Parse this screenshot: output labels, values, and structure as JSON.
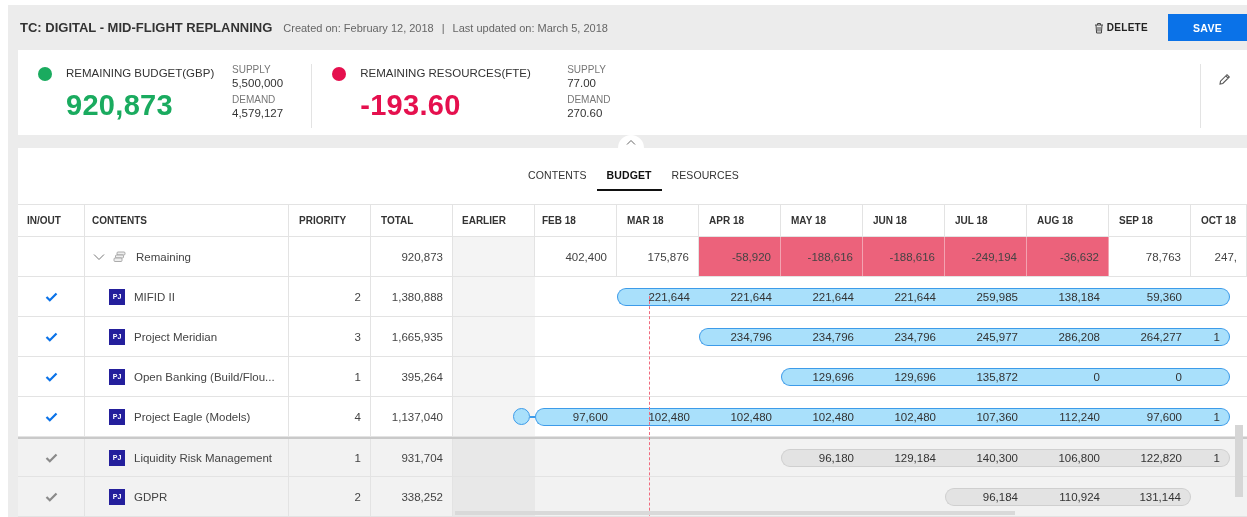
{
  "header": {
    "title": "TC: DIGITAL - MID-FLIGHT REPLANNING",
    "created": "Created on: February 12, 2018",
    "separator": "|",
    "updated": "Last updated on: March 5, 2018",
    "actions": [
      {
        "kind": "delete",
        "label": "DELETE"
      },
      {
        "kind": "save",
        "label": "SAVE"
      }
    ]
  },
  "summary": [
    {
      "label": "REMAINING BUDGET(GBP)",
      "color": "#1aab5f",
      "value": "920,873",
      "supply_label": "SUPPLY",
      "supply": "5,500,000",
      "demand_label": "DEMAND",
      "demand": "4,579,127"
    },
    {
      "label": "REMAINING RESOURCES(FTE)",
      "color": "#e5104e",
      "value": "-193.60",
      "supply_label": "SUPPLY",
      "supply": "77.00",
      "demand_label": "DEMAND",
      "demand": "270.60"
    }
  ],
  "tabs": [
    {
      "label": "CONTENTS",
      "selected": false
    },
    {
      "label": "BUDGET",
      "selected": true
    },
    {
      "label": "RESOURCES",
      "selected": false
    }
  ],
  "table": {
    "columns": [
      "IN/OUT",
      "CONTENTS",
      "PRIORITY",
      "TOTAL",
      "EARLIER",
      "FEB 18",
      "MAR 18",
      "APR 18",
      "MAY 18",
      "JUN 18",
      "JUL 18",
      "AUG 18",
      "SEP 18",
      "OCT 18"
    ],
    "rows": [
      {
        "kind": "summary",
        "name": "Remaining",
        "expanded": true,
        "total": "920,873",
        "cells": [
          {
            "value": "402,400",
            "negative": false
          },
          {
            "value": "175,876",
            "negative": false
          },
          {
            "value": "-58,920",
            "negative": true
          },
          {
            "value": "-188,616",
            "negative": true
          },
          {
            "value": "-188,616",
            "negative": true
          },
          {
            "value": "-249,194",
            "negative": true
          },
          {
            "value": "-36,632",
            "negative": true
          },
          {
            "value": "78,763",
            "negative": false
          },
          {
            "value": "247,",
            "negative": false
          }
        ]
      },
      {
        "kind": "project",
        "badge": "PJ",
        "name": "MIFID II",
        "included": true,
        "priority": "2",
        "total": "1,380,888",
        "earlier_marker": false,
        "months": [
          {
            "kind": "blank"
          },
          {
            "kind": "bar",
            "value": "221,644"
          },
          {
            "kind": "bar",
            "value": "221,644"
          },
          {
            "kind": "bar",
            "value": "221,644"
          },
          {
            "kind": "bar",
            "value": "221,644"
          },
          {
            "kind": "bar",
            "value": "259,985"
          },
          {
            "kind": "bar",
            "value": "138,184"
          },
          {
            "kind": "bar",
            "value": "59,360"
          },
          {
            "kind": "bar"
          }
        ]
      },
      {
        "kind": "project",
        "badge": "PJ",
        "name": "Project Meridian",
        "included": true,
        "priority": "3",
        "total": "1,665,935",
        "earlier_marker": false,
        "months": [
          {
            "kind": "blank"
          },
          {
            "kind": "blank"
          },
          {
            "kind": "bar",
            "value": "234,796"
          },
          {
            "kind": "bar",
            "value": "234,796"
          },
          {
            "kind": "bar",
            "value": "234,796"
          },
          {
            "kind": "bar",
            "value": "245,977"
          },
          {
            "kind": "bar",
            "value": "286,208"
          },
          {
            "kind": "bar",
            "value": "264,277"
          },
          {
            "kind": "bar",
            "value": "1"
          }
        ]
      },
      {
        "kind": "project",
        "badge": "PJ",
        "name": "Open Banking (Build/Flou...",
        "included": true,
        "priority": "1",
        "total": "395,264",
        "earlier_marker": false,
        "months": [
          {
            "kind": "blank"
          },
          {
            "kind": "blank"
          },
          {
            "kind": "blank"
          },
          {
            "kind": "bar",
            "value": "129,696"
          },
          {
            "kind": "bar",
            "value": "129,696"
          },
          {
            "kind": "bar",
            "value": "135,872"
          },
          {
            "kind": "bar",
            "value": "0"
          },
          {
            "kind": "bar",
            "value": "0"
          },
          {
            "kind": "bar"
          }
        ]
      },
      {
        "kind": "project",
        "badge": "PJ",
        "name": "Project Eagle (Models)",
        "included": true,
        "priority": "4",
        "total": "1,137,040",
        "earlier_marker": true,
        "months": [
          {
            "kind": "bar",
            "value": "97,600"
          },
          {
            "kind": "bar",
            "value": "102,480"
          },
          {
            "kind": "bar",
            "value": "102,480"
          },
          {
            "kind": "bar",
            "value": "102,480"
          },
          {
            "kind": "bar",
            "value": "102,480"
          },
          {
            "kind": "bar",
            "value": "107,360"
          },
          {
            "kind": "bar",
            "value": "112,240"
          },
          {
            "kind": "bar",
            "value": "97,600"
          },
          {
            "kind": "bar",
            "value": "1"
          }
        ]
      },
      {
        "kind": "project",
        "badge": "PJ",
        "name": "Liquidity Risk Management",
        "included": false,
        "priority": "1",
        "total": "931,704",
        "earlier_marker": false,
        "months": [
          {
            "kind": "blank"
          },
          {
            "kind": "blank"
          },
          {
            "kind": "blank"
          },
          {
            "kind": "bar",
            "value": "96,180"
          },
          {
            "kind": "bar",
            "value": "129,184"
          },
          {
            "kind": "bar",
            "value": "140,300"
          },
          {
            "kind": "bar",
            "value": "106,800"
          },
          {
            "kind": "bar",
            "value": "122,820"
          },
          {
            "kind": "bar",
            "value": "1"
          }
        ]
      },
      {
        "kind": "project",
        "badge": "PJ",
        "name": "GDPR",
        "included": false,
        "priority": "2",
        "total": "338,252",
        "earlier_marker": false,
        "months": [
          {
            "kind": "blank"
          },
          {
            "kind": "blank"
          },
          {
            "kind": "blank"
          },
          {
            "kind": "blank"
          },
          {
            "kind": "blank"
          },
          {
            "kind": "bar",
            "value": "96,184"
          },
          {
            "kind": "bar",
            "value": "110,924"
          },
          {
            "kind": "bar",
            "value": "131,144"
          },
          {
            "kind": "blank"
          }
        ]
      }
    ]
  }
}
